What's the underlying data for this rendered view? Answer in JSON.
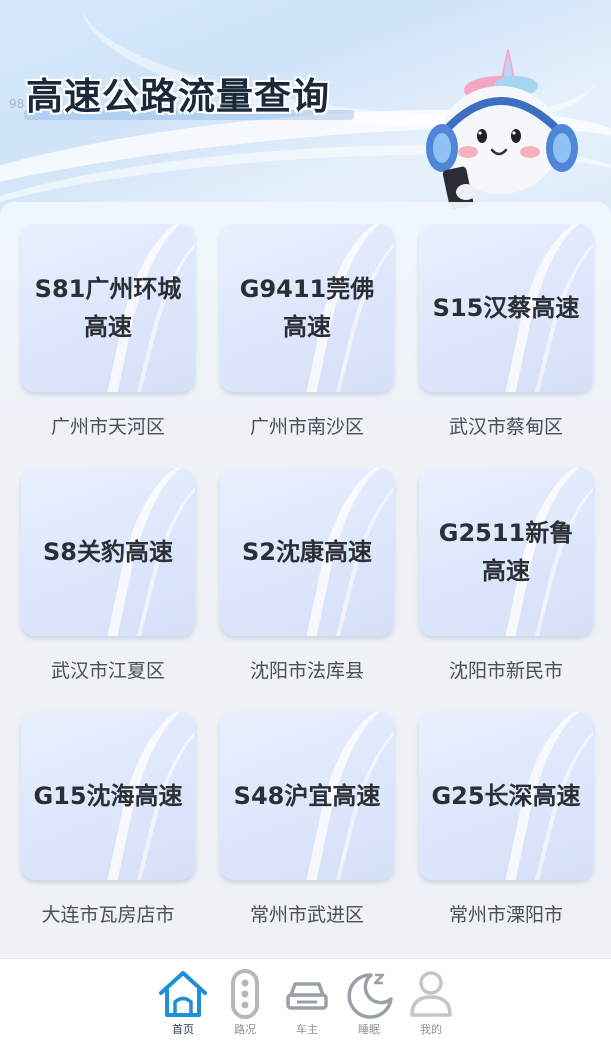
{
  "header": {
    "title": "高速公路流量查询",
    "faint_text": "98"
  },
  "roads": [
    {
      "name": "S81广州环城高速",
      "district": "广州市天河区"
    },
    {
      "name": "G9411莞佛高速",
      "district": "广州市南沙区"
    },
    {
      "name": "S15汉蔡高速",
      "district": "武汉市蔡甸区"
    },
    {
      "name": "S8关豹高速",
      "district": "武汉市江夏区"
    },
    {
      "name": "S2沈康高速",
      "district": "沈阳市法库县"
    },
    {
      "name": "G2511新鲁高速",
      "district": "沈阳市新民市"
    },
    {
      "name": "G15沈海高速",
      "district": "大连市瓦房店市"
    },
    {
      "name": "S48沪宜高速",
      "district": "常州市武进区"
    },
    {
      "name": "G25长深高速",
      "district": "常州市溧阳市"
    }
  ],
  "tabbar": {
    "items": [
      {
        "label": "首页",
        "icon": "home-icon",
        "active": true
      },
      {
        "label": "路况",
        "icon": "traffic-light-icon",
        "active": false
      },
      {
        "label": "车主",
        "icon": "car-icon",
        "active": false
      },
      {
        "label": "睡眠",
        "icon": "moon-sleep-icon",
        "active": false
      },
      {
        "label": "我的",
        "icon": "person-icon",
        "active": false
      }
    ]
  },
  "colors": {
    "active_tab": "#1e90d8",
    "inactive_tab": "#9aa0a8",
    "tile": "#dde6fb"
  }
}
